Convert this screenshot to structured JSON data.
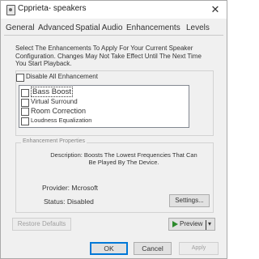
{
  "window": {
    "title": "Cpprieta- speakers",
    "close_glyph": "✕"
  },
  "tabs": [
    "General",
    "Advanced",
    "Spatial Audio",
    "Enhancements",
    "Levels"
  ],
  "instructions": "Select The Enhancements To Apply For Your Current Speaker Configuration. Changes May Not Take Effect Until The Next Time You Start Playback.",
  "disable_all": {
    "label": "Disable All Enhancement",
    "checked": false
  },
  "enhancements": [
    {
      "label": "Bass Boost",
      "checked": false,
      "selected": true
    },
    {
      "label": "Virtual Surround",
      "checked": false,
      "selected": false
    },
    {
      "label": "Room Correction",
      "checked": false,
      "selected": false
    },
    {
      "label": "Loudness Equalization",
      "checked": false,
      "selected": false
    }
  ],
  "properties": {
    "group_label": "Enhancement Properties",
    "description": "Description: Boosts The Lowest Frequencies That Can Be Played By The Device.",
    "provider": "Provider: Mcrosoft",
    "status": "Status: Disabled"
  },
  "buttons": {
    "settings": "Settings...",
    "restore_defaults": "Restore Defaults",
    "preview": "Preview",
    "ok": "OK",
    "cancel": "Cancel",
    "apply": "Apply"
  },
  "colors": {
    "accent": "#0078d7",
    "play": "#2b8a2b"
  }
}
